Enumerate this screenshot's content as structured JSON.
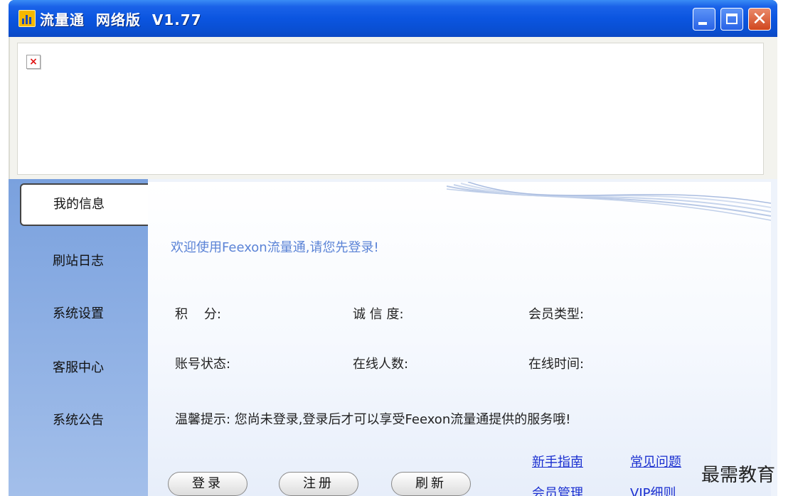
{
  "window": {
    "title": "流量通  网络版  V1.77",
    "controls": {
      "minimize_icon": "minimize-icon",
      "maximize_icon": "maximize-icon",
      "close_icon": "close-icon"
    },
    "titlebar_color": "#0b55e0"
  },
  "banner": {
    "broken_image_icon": "broken-image-icon"
  },
  "sidebar": {
    "items": [
      {
        "label": "我的信息",
        "active": true
      },
      {
        "label": "刷站日志"
      },
      {
        "label": "系统设置"
      },
      {
        "label": "客服中心"
      },
      {
        "label": "系统公告"
      }
    ]
  },
  "main": {
    "welcome": "欢迎使用Feexon流量通,请您先登录!",
    "fields": {
      "points": "积    分:",
      "credibility": "诚 信 度:",
      "member_type": "会员类型:",
      "account_status": "账号状态:",
      "online_users": "在线人数:",
      "online_time": "在线时间:"
    },
    "tip": "温馨提示: 您尚未登录,登录后才可以享受Feexon流量通提供的服务哦!",
    "buttons": {
      "login": "登录",
      "register": "注册",
      "refresh": "刷新"
    },
    "links": {
      "newbie_guide": "新手指南",
      "faq": "常见问题",
      "member_management": "会员管理",
      "vip_rules": "VIP细则"
    }
  },
  "watermark": "最需教育"
}
